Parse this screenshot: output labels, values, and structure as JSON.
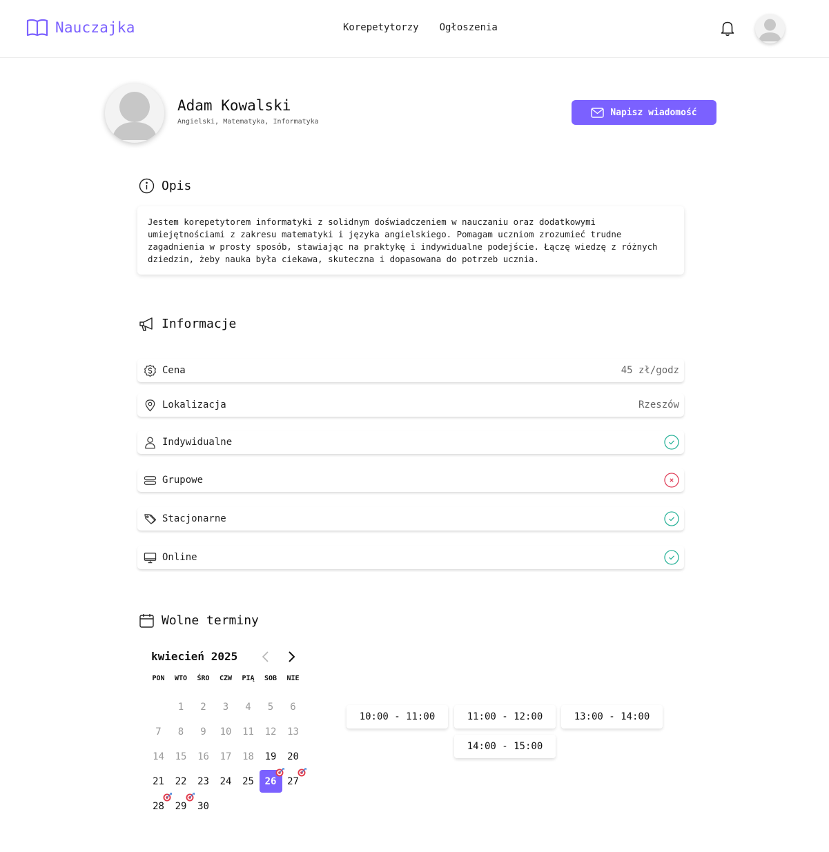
{
  "brand": {
    "name": "Nauczajka",
    "color": "#7b61ff",
    "logo_icon": "open-book-icon"
  },
  "nav": {
    "items": [
      "Korepetytorzy",
      "Ogłoszenia"
    ]
  },
  "header_icons": {
    "bell": "bell-icon",
    "avatar": "user-avatar"
  },
  "profile": {
    "name": "Adam Kowalski",
    "subjects": "Angielski, Matematyka, Informatyka",
    "message_button": "Napisz wiadomość"
  },
  "description": {
    "title": "Opis",
    "text": "Jestem korepetytorem informatyki z solidnym doświadczeniem w nauczaniu oraz dodatkowymi umiejętnościami z zakresu matematyki i języka angielskiego. Pomagam uczniom zrozumieć trudne zagadnienia w prosty sposób, stawiając na praktykę i indywidualne podejście. Łączę wiedzę z różnych dziedzin, żeby nauka była ciekawa, skuteczna i dopasowana do potrzeb ucznia."
  },
  "info": {
    "title": "Informacje",
    "rows": [
      {
        "label": "Cena",
        "value": "45 zł/godz",
        "icon": "dollar-badge-icon"
      },
      {
        "label": "Lokalizacja",
        "value": "Rzeszów",
        "icon": "map-pin-icon"
      },
      {
        "label": "Indywidualne",
        "status": "yes",
        "icon": "user-icon"
      },
      {
        "label": "Grupowe",
        "status": "no",
        "icon": "group-icon"
      },
      {
        "label": "Stacjonarne",
        "status": "yes",
        "icon": "tag-icon"
      },
      {
        "label": "Online",
        "status": "yes",
        "icon": "monitor-icon"
      }
    ],
    "colors": {
      "yes": "#2bb39a",
      "no": "#e0405a"
    }
  },
  "schedule": {
    "title": "Wolne terminy",
    "month_label": "kwiecień 2025",
    "weekdays": [
      "PON",
      "WTO",
      "ŚRO",
      "CZW",
      "PIĄ",
      "SOB",
      "NIE"
    ],
    "first_weekday_offset": 1,
    "days_in_month": 30,
    "last_past_day": 18,
    "selected_day": 26,
    "marked_days": [
      26,
      27,
      28,
      29
    ],
    "slots": [
      "10:00 - 11:00",
      "11:00 - 12:00",
      "13:00 - 14:00",
      "14:00 - 15:00"
    ]
  }
}
